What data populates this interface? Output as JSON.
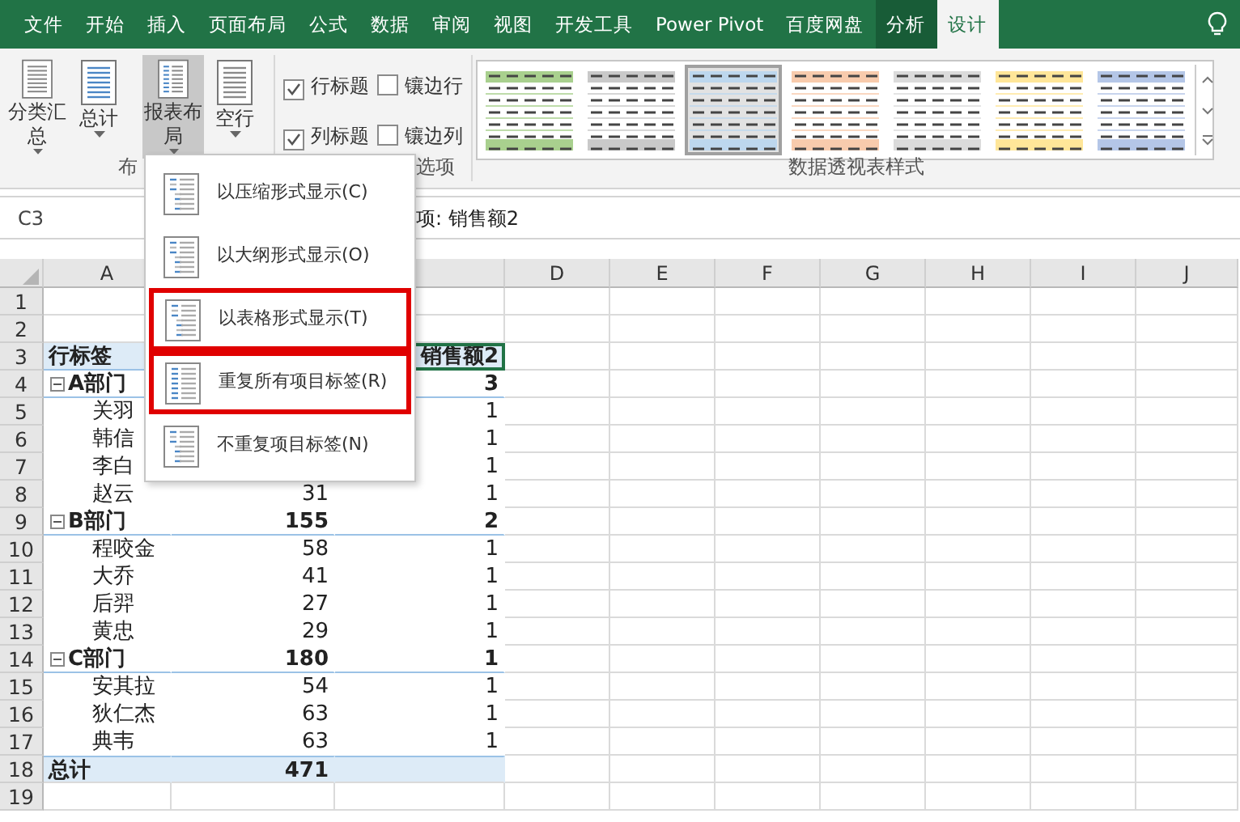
{
  "tabs": [
    {
      "label": "文件",
      "selected": false,
      "kind": "normal"
    },
    {
      "label": "开始",
      "selected": false,
      "kind": "normal"
    },
    {
      "label": "插入",
      "selected": false,
      "kind": "normal"
    },
    {
      "label": "页面布局",
      "selected": false,
      "kind": "normal"
    },
    {
      "label": "公式",
      "selected": false,
      "kind": "normal"
    },
    {
      "label": "数据",
      "selected": false,
      "kind": "normal"
    },
    {
      "label": "审阅",
      "selected": false,
      "kind": "normal"
    },
    {
      "label": "视图",
      "selected": false,
      "kind": "normal"
    },
    {
      "label": "开发工具",
      "selected": false,
      "kind": "normal"
    },
    {
      "label": "Power Pivot",
      "selected": false,
      "kind": "normal"
    },
    {
      "label": "百度网盘",
      "selected": false,
      "kind": "normal"
    },
    {
      "label": "分析",
      "selected": false,
      "kind": "context"
    },
    {
      "label": "设计",
      "selected": true,
      "kind": "context"
    }
  ],
  "ribbon": {
    "layout_group": {
      "label": "布",
      "buttons": [
        {
          "label": "分类汇总",
          "pressed": false
        },
        {
          "label": "总计",
          "pressed": false
        },
        {
          "label": "报表布局",
          "pressed": true
        },
        {
          "label": "空行",
          "pressed": false
        }
      ]
    },
    "options_group": {
      "label": "选项",
      "checkboxes": [
        {
          "label": "行标题",
          "checked": true
        },
        {
          "label": "镶边行",
          "checked": false
        },
        {
          "label": "列标题",
          "checked": true
        },
        {
          "label": "镶边列",
          "checked": false
        }
      ]
    },
    "styles_group": {
      "label": "数据透视表样式",
      "styles": [
        {
          "color": "#a9d08e",
          "selected": false
        },
        {
          "color": "#c9c9c9",
          "selected": false
        },
        {
          "color": "#bdd7ee",
          "selected": true
        },
        {
          "color": "#f8cbad",
          "selected": false
        },
        {
          "color": "#dbdbdb",
          "selected": false
        },
        {
          "color": "#ffe699",
          "selected": false
        },
        {
          "color": "#b4c6e7",
          "selected": false
        }
      ]
    }
  },
  "formula_bar": {
    "name_box": "C3",
    "formula": "项: 销售额2"
  },
  "columns": [
    {
      "label": "A"
    },
    {},
    {},
    {
      "label": "D"
    },
    {
      "label": "E"
    },
    {
      "label": "F"
    },
    {
      "label": "G"
    },
    {
      "label": "H"
    },
    {
      "label": "I"
    },
    {
      "label": "J"
    }
  ],
  "rows": [
    {
      "n": "1",
      "kind": "blank"
    },
    {
      "n": "2",
      "kind": "blank"
    },
    {
      "n": "3",
      "kind": "header",
      "a": "行标签",
      "c": "销售额2",
      "active": true
    },
    {
      "n": "4",
      "kind": "group",
      "a": "A部门",
      "c": "3",
      "expanded": true
    },
    {
      "n": "5",
      "kind": "item",
      "a": "关羽",
      "c": "1"
    },
    {
      "n": "6",
      "kind": "item",
      "a": "韩信",
      "c": "1"
    },
    {
      "n": "7",
      "kind": "item",
      "a": "李白",
      "c": "1"
    },
    {
      "n": "8",
      "kind": "item",
      "a": "赵云",
      "b": "31",
      "c": "1"
    },
    {
      "n": "9",
      "kind": "group",
      "a": "B部门",
      "b": "155",
      "c": "2",
      "expanded": true
    },
    {
      "n": "10",
      "kind": "item",
      "a": "程咬金",
      "b": "58",
      "c": "1"
    },
    {
      "n": "11",
      "kind": "item",
      "a": "大乔",
      "b": "41",
      "c": "1"
    },
    {
      "n": "12",
      "kind": "item",
      "a": "后羿",
      "b": "27",
      "c": "1"
    },
    {
      "n": "13",
      "kind": "item",
      "a": "黄忠",
      "b": "29",
      "c": "1"
    },
    {
      "n": "14",
      "kind": "group",
      "a": "C部门",
      "b": "180",
      "c": "1",
      "expanded": true
    },
    {
      "n": "15",
      "kind": "item",
      "a": "安其拉",
      "b": "54",
      "c": "1"
    },
    {
      "n": "16",
      "kind": "item",
      "a": "狄仁杰",
      "b": "63",
      "c": "1"
    },
    {
      "n": "17",
      "kind": "item",
      "a": "典韦",
      "b": "63",
      "c": "1"
    },
    {
      "n": "18",
      "kind": "total",
      "a": "总计",
      "b": "471"
    },
    {
      "n": "19",
      "kind": "blank"
    }
  ],
  "layout_menu": {
    "items": [
      {
        "label": "以压缩形式显示(C)",
        "highlighted": false
      },
      {
        "label": "以大纲形式显示(O)",
        "highlighted": false
      },
      {
        "label": "以表格形式显示(T)",
        "highlighted": true
      },
      {
        "label": "重复所有项目标签(R)",
        "highlighted": true
      },
      {
        "label": "不重复项目标签(N)",
        "highlighted": false
      }
    ]
  }
}
